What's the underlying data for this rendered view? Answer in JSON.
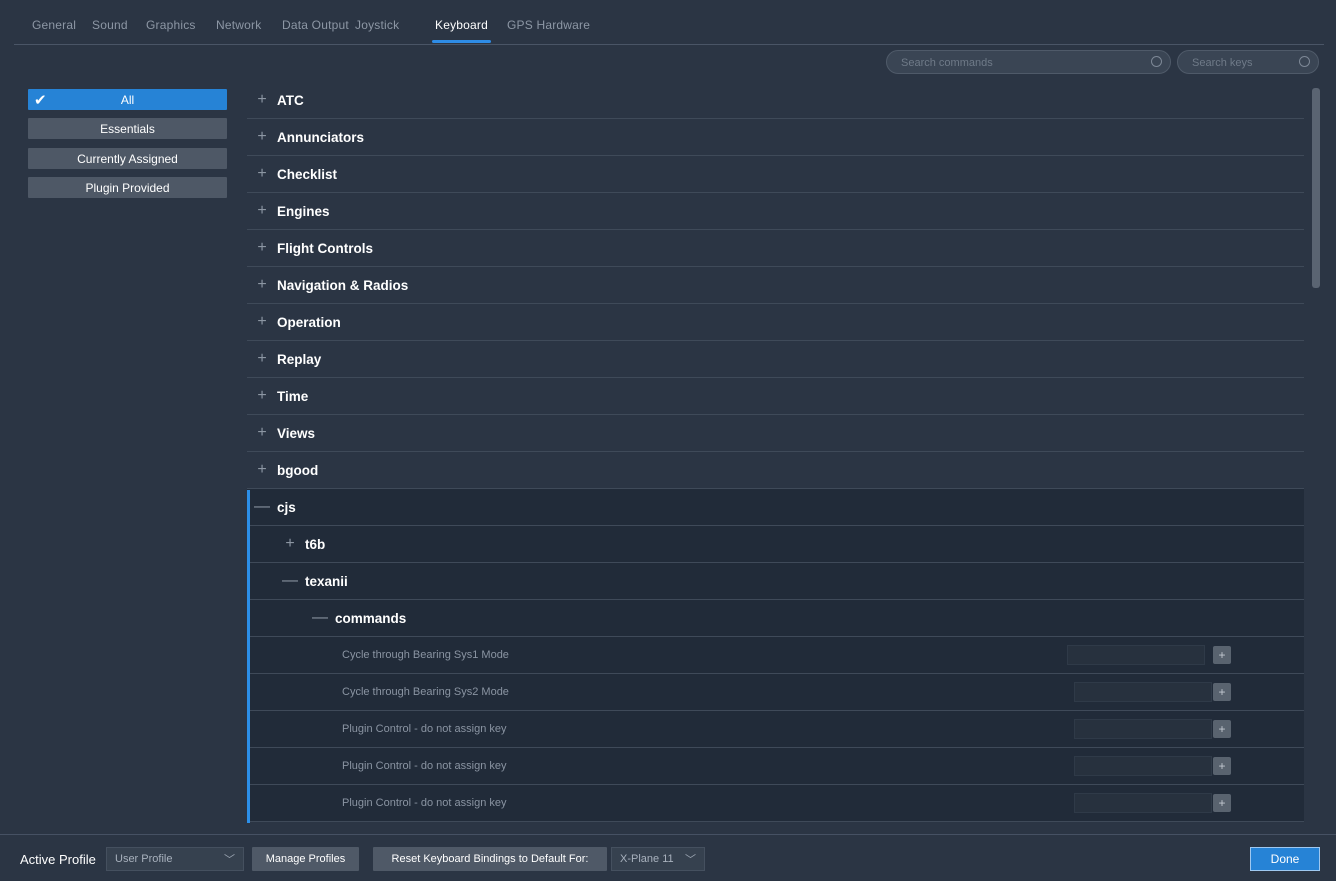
{
  "tabs": [
    {
      "label": "General"
    },
    {
      "label": "Sound"
    },
    {
      "label": "Graphics"
    },
    {
      "label": "Network"
    },
    {
      "label": "Data Output"
    },
    {
      "label": "Joystick"
    },
    {
      "label": "Keyboard",
      "active": true
    },
    {
      "label": "GPS Hardware"
    }
  ],
  "search": {
    "commands_placeholder": "Search commands",
    "keys_placeholder": "Search keys"
  },
  "filters": [
    {
      "label": "All",
      "selected": true
    },
    {
      "label": "Essentials"
    },
    {
      "label": "Currently Assigned"
    },
    {
      "label": "Plugin Provided"
    }
  ],
  "categories": [
    {
      "label": "ATC",
      "state": "+"
    },
    {
      "label": "Annunciators",
      "state": "+"
    },
    {
      "label": "Checklist",
      "state": "+"
    },
    {
      "label": "Engines",
      "state": "+"
    },
    {
      "label": "Flight Controls",
      "state": "+"
    },
    {
      "label": "Navigation & Radios",
      "state": "+"
    },
    {
      "label": "Operation",
      "state": "+"
    },
    {
      "label": "Replay",
      "state": "+"
    },
    {
      "label": "Time",
      "state": "+"
    },
    {
      "label": "Views",
      "state": "+"
    },
    {
      "label": "bgood",
      "state": "+"
    },
    {
      "label": "cjs",
      "state": "—"
    },
    {
      "label": "t6b",
      "state": "+"
    },
    {
      "label": "texanii",
      "state": "—"
    },
    {
      "label": "commands",
      "state": "—"
    }
  ],
  "commands": [
    {
      "label": "Cycle through Bearing Sys1 Mode",
      "add": "+"
    },
    {
      "label": "Cycle through Bearing Sys2 Mode",
      "add": "+"
    },
    {
      "label": "Plugin Control - do not assign key",
      "add": "+"
    },
    {
      "label": "Plugin Control - do not assign key",
      "add": "+"
    },
    {
      "label": "Plugin Control - do not assign key",
      "add": "+"
    }
  ],
  "bottom": {
    "active_profile_label": "Active Profile",
    "profile_value": "User Profile",
    "manage_profiles": "Manage Profiles",
    "reset_label": "Reset Keyboard Bindings to Default For:",
    "reset_value": "X-Plane 11",
    "done": "Done"
  },
  "icons": {
    "check": "✔",
    "chevron": "﹀"
  },
  "colors": {
    "accent": "#2683d6",
    "background": "#2b3544",
    "row_border": "#3f4a59"
  }
}
